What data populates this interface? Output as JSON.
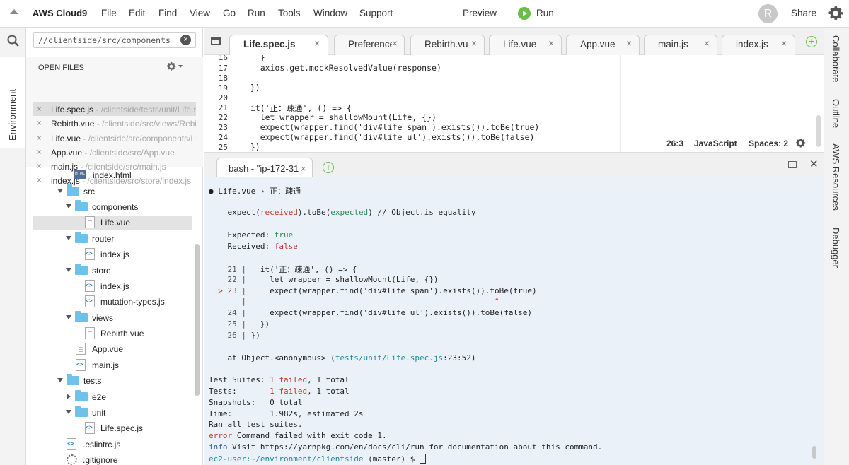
{
  "menubar": {
    "brand": "AWS Cloud9",
    "menus": [
      "File",
      "Edit",
      "Find",
      "View",
      "Go",
      "Run",
      "Tools",
      "Window",
      "Support"
    ],
    "preview": "Preview",
    "run": "Run",
    "avatar_letter": "R",
    "share": "Share"
  },
  "left_panel": {
    "vertical_tab": "Environment",
    "search_value": "//clientside/src/components",
    "open_files_title": "OPEN FILES",
    "open_files": [
      {
        "name": "Life.spec.js",
        "path": " - /clientside/tests/unit/Life.spec.js"
      },
      {
        "name": "Rebirth.vue",
        "path": " - /clientside/src/views/Rebirth.vue"
      },
      {
        "name": "Life.vue",
        "path": " - /clientside/src/components/Life.vue"
      },
      {
        "name": "App.vue",
        "path": " - /clientside/src/App.vue"
      },
      {
        "name": "main.js",
        "path": " - /clientside/src/main.js"
      },
      {
        "name": "index.js",
        "path": " - /clientside/src/store/index.js"
      }
    ],
    "tree": [
      {
        "label": "index.html"
      },
      {
        "label": "src"
      },
      {
        "label": "components"
      },
      {
        "label": "Life.vue"
      },
      {
        "label": "router"
      },
      {
        "label": "index.js"
      },
      {
        "label": "store"
      },
      {
        "label": "index.js"
      },
      {
        "label": "mutation-types.js"
      },
      {
        "label": "views"
      },
      {
        "label": "Rebirth.vue"
      },
      {
        "label": "App.vue"
      },
      {
        "label": "main.js"
      },
      {
        "label": "tests"
      },
      {
        "label": "e2e"
      },
      {
        "label": "unit"
      },
      {
        "label": "Life.spec.js"
      },
      {
        "label": ".eslintrc.js"
      },
      {
        "label": ".gitignore"
      }
    ]
  },
  "editor_tabs": [
    "Life.spec.js",
    "Preferences",
    "Rebirth.vue",
    "Life.vue",
    "App.vue",
    "main.js",
    "index.js"
  ],
  "editor": {
    "line_numbers": [
      "16",
      "17",
      "18",
      "19",
      "20",
      "21",
      "22",
      "23",
      "24",
      "25"
    ],
    "lines": [
      "    }",
      "    axios.get.mockResolvedValue(response)",
      "",
      "  })",
      "",
      "  it('正：疎通', () => {",
      "    let wrapper = shallowMount(Life, {})",
      "    expect(wrapper.find('div#life span').exists()).toBe(true)",
      "    expect(wrapper.find('div#life ul').exists()).toBe(false)",
      "  })"
    ],
    "status": {
      "position": "26:3",
      "language": "JavaScript",
      "spaces": "Spaces: 2"
    }
  },
  "terminal": {
    "tab_label": "bash - \"ip-172-31",
    "failed_title": "● Life.vue › 正：疎通",
    "expect_line_a": "expect(",
    "expect_received": "received",
    "expect_line_b": ").toBe(",
    "expect_expected": "expected",
    "expect_line_c": ") // Object.is equality",
    "expected_label": "Expected: ",
    "expected_value": "true",
    "received_label": "Received: ",
    "received_value": "false",
    "snippet": [
      {
        "prefix": "    21 |   ",
        "code": "it('正：疎通', () => {"
      },
      {
        "prefix": "    22 |     ",
        "code": "let wrapper = shallowMount(Life, {})"
      },
      {
        "prefix": "  > 23 |     ",
        "code": "expect(wrapper.find('div#life span').exists()).toBe(true)"
      },
      {
        "prefix": "       |                                                     ",
        "code": "^"
      },
      {
        "prefix": "    24 |     ",
        "code": "expect(wrapper.find('div#life ul').exists()).toBe(false)"
      },
      {
        "prefix": "    25 |   ",
        "code": "})"
      },
      {
        "prefix": "    26 | ",
        "code": "})"
      }
    ],
    "at_line_a": "    at Object.<anonymous> (",
    "at_line_path": "tests/unit/Life.spec.js",
    "at_line_b": ":23:52)",
    "summary": [
      {
        "label": "Test Suites: ",
        "failed": "1 failed",
        "rest": ", 1 total"
      },
      {
        "label": "Tests:       ",
        "failed": "1 failed",
        "rest": ", 1 total"
      }
    ],
    "snapshots": "Snapshots:   0 total",
    "time": "Time:        1.982s, estimated 2s",
    "ran_all": "Ran all test suites.",
    "error_prefix": "error",
    "error_text": " Command failed with exit code 1.",
    "info_prefix": "info",
    "info_text": " Visit https://yarnpkg.com/en/docs/cli/run for documentation about this command.",
    "prompt_user": "ec2-user:~/environment/clientside",
    "prompt_rest": " (master) $ "
  },
  "right_panel": [
    "Collaborate",
    "Outline",
    "AWS Resources",
    "Debugger"
  ]
}
